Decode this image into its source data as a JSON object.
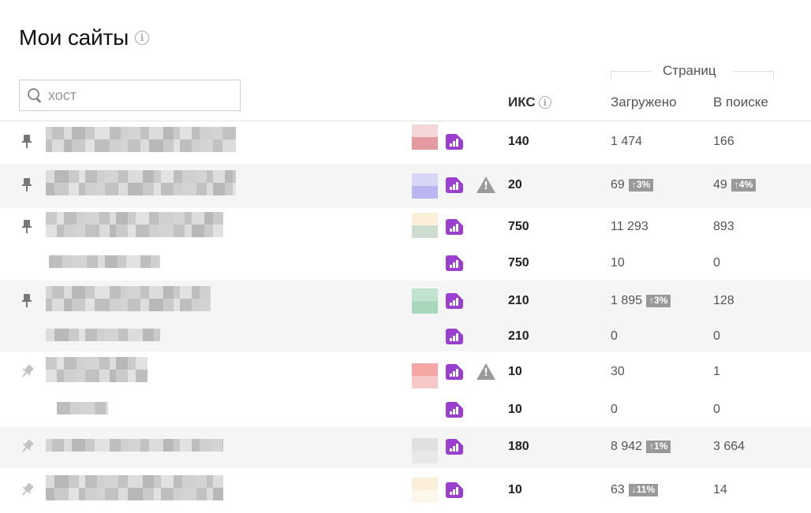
{
  "page": {
    "title": "Мои сайты"
  },
  "search": {
    "placeholder": "хост",
    "value": ""
  },
  "columns": {
    "group_label": "Страниц",
    "iks": "ИКС",
    "loaded": "Загружено",
    "in_search": "В поиске"
  },
  "icons": {
    "pin": "pin-icon",
    "metrica": "metrica-icon",
    "warning": "warning-icon",
    "search": "search-icon",
    "info": "info-icon"
  },
  "colors": {
    "metrica": "#9b3fd0",
    "badge": "#999999",
    "row_shade": "#f5f5f5"
  },
  "rows": [
    {
      "pinned": true,
      "warning": false,
      "iks": "140",
      "loaded": "1 474",
      "loaded_change": "",
      "in_search": "166",
      "in_search_change": ""
    },
    {
      "pinned": true,
      "warning": true,
      "iks": "20",
      "loaded": "69",
      "loaded_change": "↑3%",
      "in_search": "49",
      "in_search_change": "↑4%"
    },
    {
      "pinned": true,
      "warning": false,
      "iks": "750",
      "loaded": "11 293",
      "loaded_change": "",
      "in_search": "893",
      "in_search_change": ""
    },
    {
      "pinned": null,
      "warning": false,
      "iks": "750",
      "loaded": "10",
      "loaded_change": "",
      "in_search": "0",
      "in_search_change": ""
    },
    {
      "pinned": true,
      "warning": false,
      "iks": "210",
      "loaded": "1 895",
      "loaded_change": "↑3%",
      "in_search": "128",
      "in_search_change": ""
    },
    {
      "pinned": null,
      "warning": false,
      "iks": "210",
      "loaded": "0",
      "loaded_change": "",
      "in_search": "0",
      "in_search_change": ""
    },
    {
      "pinned": false,
      "warning": true,
      "iks": "10",
      "loaded": "30",
      "loaded_change": "",
      "in_search": "1",
      "in_search_change": ""
    },
    {
      "pinned": null,
      "warning": false,
      "iks": "10",
      "loaded": "0",
      "loaded_change": "",
      "in_search": "0",
      "in_search_change": ""
    },
    {
      "pinned": false,
      "warning": false,
      "iks": "180",
      "loaded": "8 942",
      "loaded_change": "↑1%",
      "in_search": "3 664",
      "in_search_change": ""
    },
    {
      "pinned": false,
      "warning": false,
      "iks": "10",
      "loaded": "63",
      "loaded_change": "↓11%",
      "in_search": "14",
      "in_search_change": ""
    }
  ]
}
